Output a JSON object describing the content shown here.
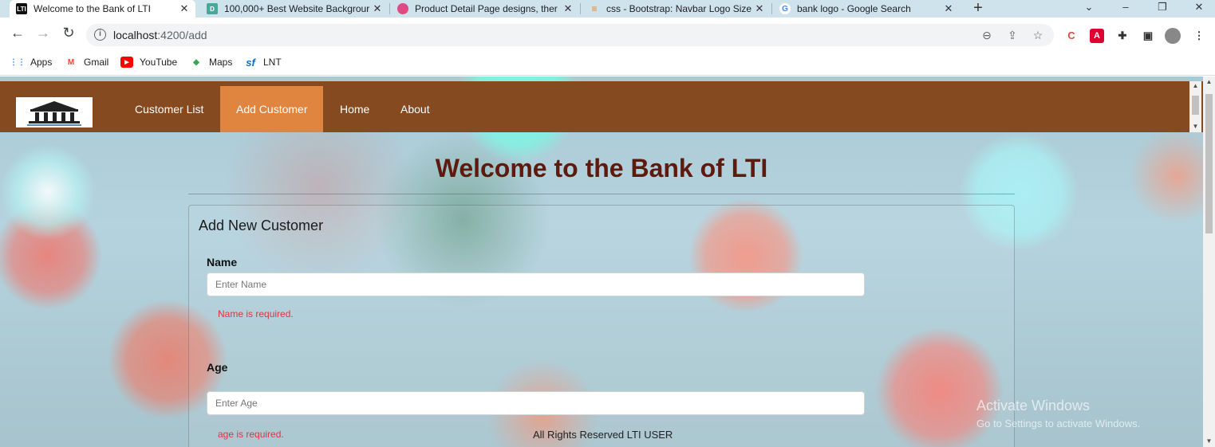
{
  "browser": {
    "tabs": [
      {
        "title": "Welcome to the Bank of LTI",
        "favicon": "LTI",
        "active": true
      },
      {
        "title": "100,000+ Best Website Backgrour",
        "favicon": "D",
        "active": false
      },
      {
        "title": "Product Detail Page designs, ther",
        "favicon": "dribbble",
        "active": false
      },
      {
        "title": "css - Bootstrap: Navbar Logo Size",
        "favicon": "stackoverflow",
        "active": false
      },
      {
        "title": "bank logo - Google Search",
        "favicon": "G",
        "active": false
      }
    ],
    "new_tab": "+",
    "url_host": "localhost",
    "url_path": ":4200/add",
    "bookmarks": [
      {
        "label": "Apps"
      },
      {
        "label": "Gmail"
      },
      {
        "label": "YouTube"
      },
      {
        "label": "Maps"
      },
      {
        "label": "LNT"
      }
    ]
  },
  "site": {
    "nav": {
      "items": [
        {
          "label": "Customer List",
          "active": false
        },
        {
          "label": "Add Customer",
          "active": true
        },
        {
          "label": "Home",
          "active": false
        },
        {
          "label": "About",
          "active": false
        }
      ]
    },
    "heading": "Welcome to the Bank of LTI",
    "form": {
      "title": "Add New Customer",
      "name_label": "Name",
      "name_placeholder": "Enter Name",
      "name_error": "Name is required.",
      "age_label": "Age",
      "age_placeholder": "Enter Age",
      "age_error": "age is required."
    },
    "footer": "All Rights Reserved LTI USER"
  },
  "os_watermark": {
    "line1": "Activate Windows",
    "line2": "Go to Settings to activate Windows."
  },
  "colors": {
    "navbar": "#854a1f",
    "nav_active": "#e0853f",
    "heading": "#5e1a0e",
    "error": "#dc3545"
  }
}
